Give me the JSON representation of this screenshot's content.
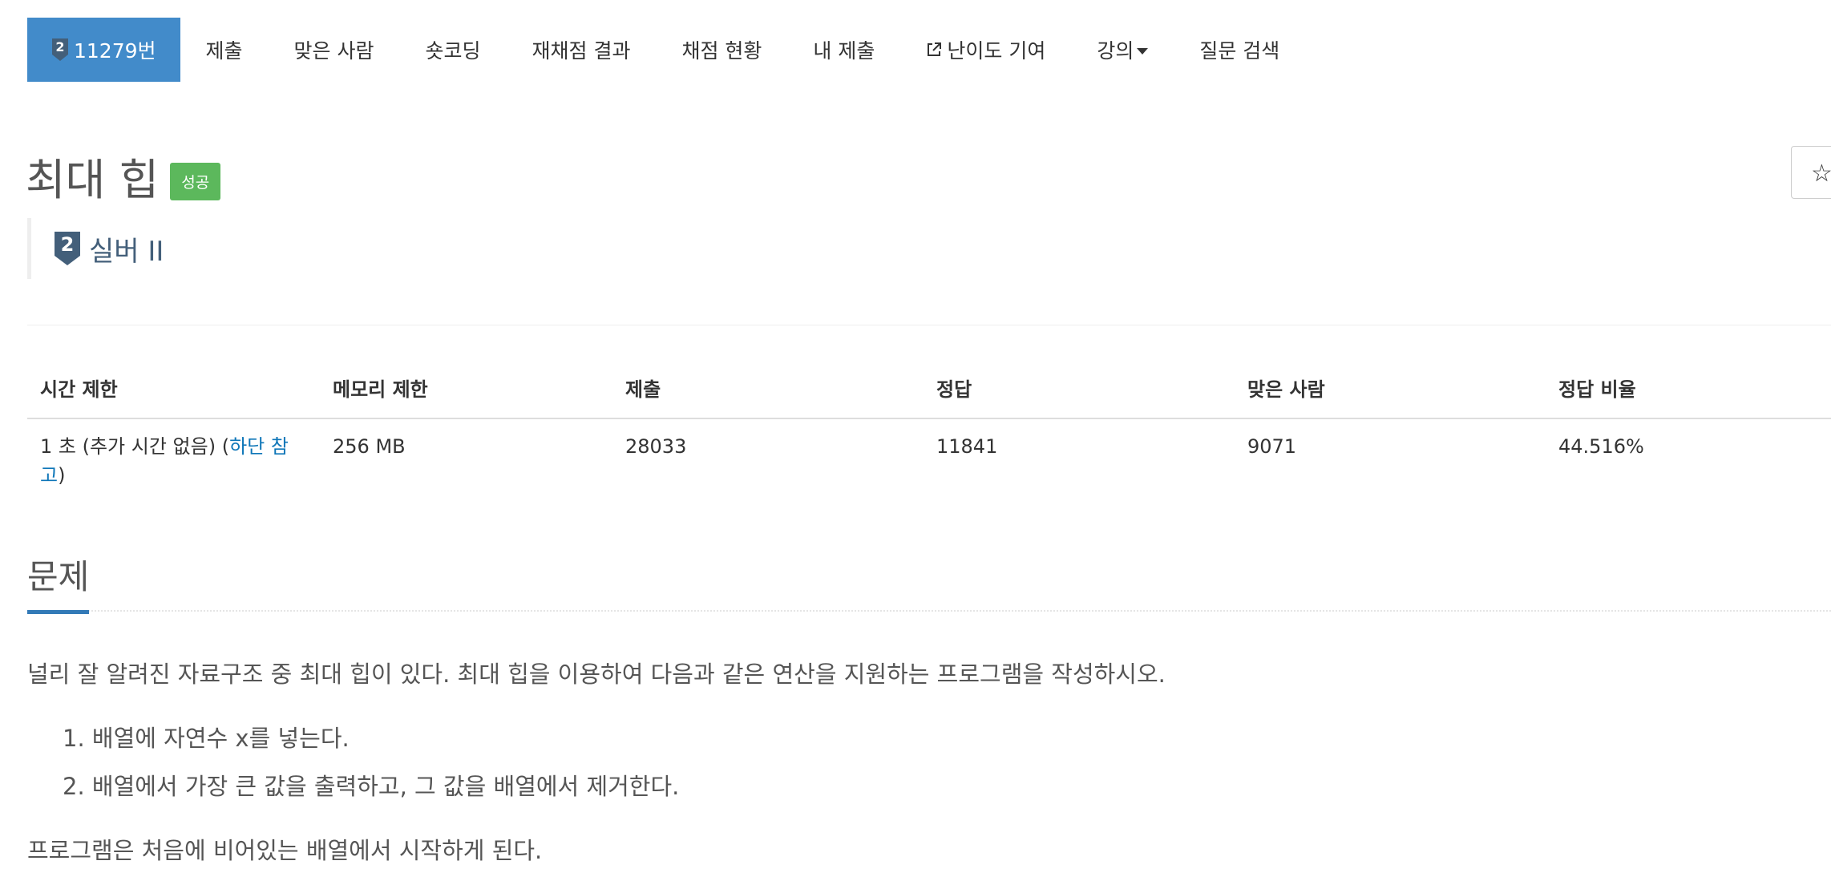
{
  "nav": {
    "problem_tab": "11279번",
    "tier_icon_text": "2",
    "tabs": [
      "제출",
      "맞은 사람",
      "숏코딩",
      "재채점 결과",
      "채점 현황",
      "내 제출"
    ],
    "contribute_label": "난이도 기여",
    "lecture_label": "강의",
    "question_label": "질문 검색"
  },
  "problem": {
    "title": "최대 힙",
    "status_badge": "성공",
    "tier_icon_text": "2",
    "tier_label": "실버 II",
    "star_icon": "☆"
  },
  "info_table": {
    "headers": [
      "시간 제한",
      "메모리 제한",
      "제출",
      "정답",
      "맞은 사람",
      "정답 비율"
    ],
    "time_limit_prefix": "1 초 (추가 시간 없음) (",
    "time_limit_link": "하단 참고",
    "time_limit_suffix": ")",
    "memory_limit": "256 MB",
    "submissions": "28033",
    "accepted": "11841",
    "solvers": "9071",
    "ratio": "44.516%"
  },
  "section": {
    "title": "문제",
    "description": "널리 잘 알려진 자료구조 중 최대 힙이 있다. 최대 힙을 이용하여 다음과 같은 연산을 지원하는 프로그램을 작성하시오.",
    "operations": [
      "1. 배열에 자연수 x를 넣는다.",
      "2. 배열에서 가장 큰 값을 출력하고, 그 값을 배열에서 제거한다."
    ],
    "after": "프로그램은 처음에 비어있는 배열에서 시작하게 된다."
  },
  "colors": {
    "active_tab": "#428bca",
    "success": "#5cb85c",
    "tier": "#435f7a",
    "link": "#0e76b8",
    "section_underline": "#337ab7"
  },
  "icons": [
    "silver-tier-icon",
    "external-link-icon",
    "caret-down-icon",
    "star-icon"
  ]
}
